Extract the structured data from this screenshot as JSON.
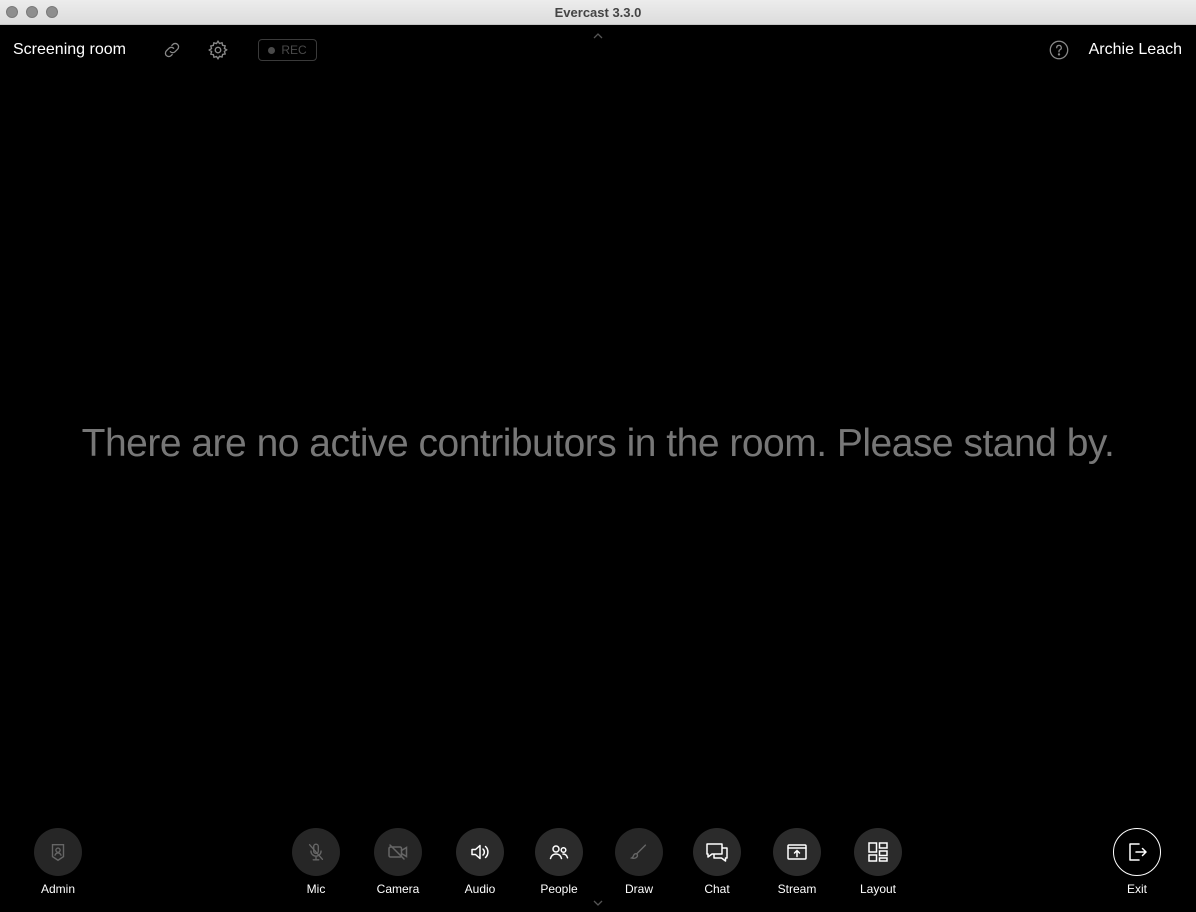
{
  "window": {
    "title": "Evercast 3.3.0"
  },
  "header": {
    "room_name": "Screening room",
    "rec_label": "REC",
    "user_name": "Archie Leach"
  },
  "main": {
    "message": "There are no active contributors in the room. Please stand by."
  },
  "toolbar": {
    "admin": "Admin",
    "mic": "Mic",
    "camera": "Camera",
    "audio": "Audio",
    "people": "People",
    "draw": "Draw",
    "chat": "Chat",
    "stream": "Stream",
    "layout": "Layout",
    "exit": "Exit"
  },
  "icons": {
    "traffic_lights": "traffic-light-icons",
    "link": "link-icon",
    "settings": "gear-icon",
    "record": "record-dot-icon",
    "help": "help-icon",
    "admin": "admin-badge-icon",
    "mic": "mic-off-icon",
    "camera": "camera-off-icon",
    "audio": "speaker-icon",
    "people": "people-icon",
    "draw": "brush-icon",
    "chat": "chat-icon",
    "stream": "stream-icon",
    "layout": "layout-grid-icon",
    "exit": "exit-icon"
  },
  "colors": {
    "background": "#000000",
    "button_fill": "#2b2b2b",
    "message_text": "#777777"
  }
}
